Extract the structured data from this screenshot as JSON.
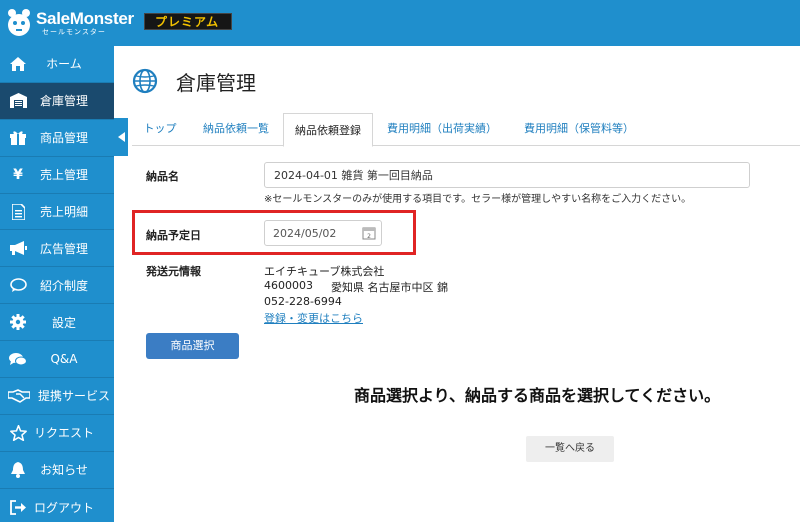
{
  "app": {
    "logo_title": "SaleMonster",
    "logo_sub": "セールモンスター",
    "badge": "プレミアム"
  },
  "sidebar": {
    "items": [
      {
        "label": "ホーム",
        "icon": "home-icon"
      },
      {
        "label": "倉庫管理",
        "icon": "warehouse-icon"
      },
      {
        "label": "商品管理",
        "icon": "gift-icon"
      },
      {
        "label": "売上管理",
        "icon": "yen-icon"
      },
      {
        "label": "売上明細",
        "icon": "document-icon"
      },
      {
        "label": "広告管理",
        "icon": "megaphone-icon"
      },
      {
        "label": "紹介制度",
        "icon": "chat-bubble-icon"
      },
      {
        "label": "設定",
        "icon": "gear-icon"
      },
      {
        "label": "Q&A",
        "icon": "chat-bubbles-icon"
      },
      {
        "label": "提携サービス",
        "icon": "handshake-icon"
      },
      {
        "label": "リクエスト",
        "icon": "star-icon"
      },
      {
        "label": "お知らせ",
        "icon": "bell-icon"
      },
      {
        "label": "ログアウト",
        "icon": "logout-icon"
      }
    ],
    "active_index": 1
  },
  "page": {
    "title": "倉庫管理"
  },
  "tabs": [
    {
      "label": "トップ"
    },
    {
      "label": "納品依頼一覧"
    },
    {
      "label": "納品依頼登録"
    },
    {
      "label": "費用明細（出荷実績）"
    },
    {
      "label": "費用明細（保管料等）"
    }
  ],
  "form": {
    "name_label": "納品名",
    "name_value": "2024-04-01 雑貨 第一回目納品",
    "name_hint": "※セールモンスターのみが使用する項目です。セラー様が管理しやすい名称をご入力ください。",
    "date_label": "納品予定日",
    "date_value": "2024/05/02",
    "sender_label": "発送元情報",
    "sender_company": "エイチキューブ株式会社",
    "sender_zip": "4600003",
    "sender_address": "愛知県 名古屋市中区 錦",
    "sender_phone": "052-228-6994",
    "sender_link": "登録・変更はこちら",
    "select_button": "商品選択",
    "message": "商品選択より、納品する商品を選択してください。",
    "back_button": "一覧へ戻る"
  }
}
